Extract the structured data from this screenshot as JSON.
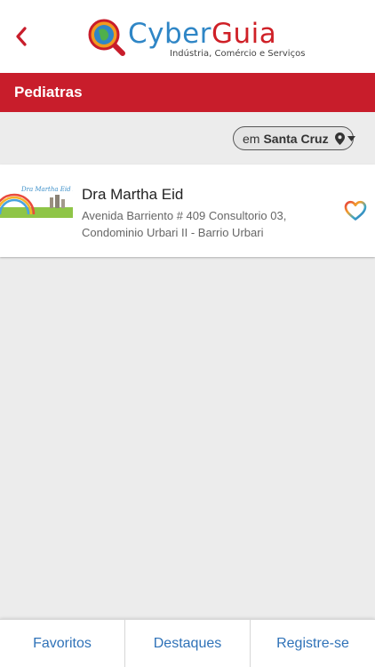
{
  "header": {
    "logo_cyber": "Cyber",
    "logo_guia": "Guia",
    "logo_tagline": "Indústria, Comércio e Serviços"
  },
  "titlebar": {
    "title": "Pediatras"
  },
  "location": {
    "prefix": "em",
    "city": "Santa Cruz"
  },
  "listing": {
    "name": "Dra Martha Eid",
    "address": "Avenida Barriento # 409 Consultorio 03, Condominio Urbari II - Barrio Urbari",
    "thumb_text": "Dra Martha Eid M."
  },
  "bottom_nav": {
    "favoritos": "Favoritos",
    "destaques": "Destaques",
    "registre": "Registre-se"
  },
  "colors": {
    "brand_red": "#c81d2b",
    "link_blue": "#2f72b8",
    "logo_blue": "#2f86c6"
  },
  "icons": [
    "back-chevron-icon",
    "map-pin-icon",
    "caret-down-icon",
    "heart-icon"
  ]
}
